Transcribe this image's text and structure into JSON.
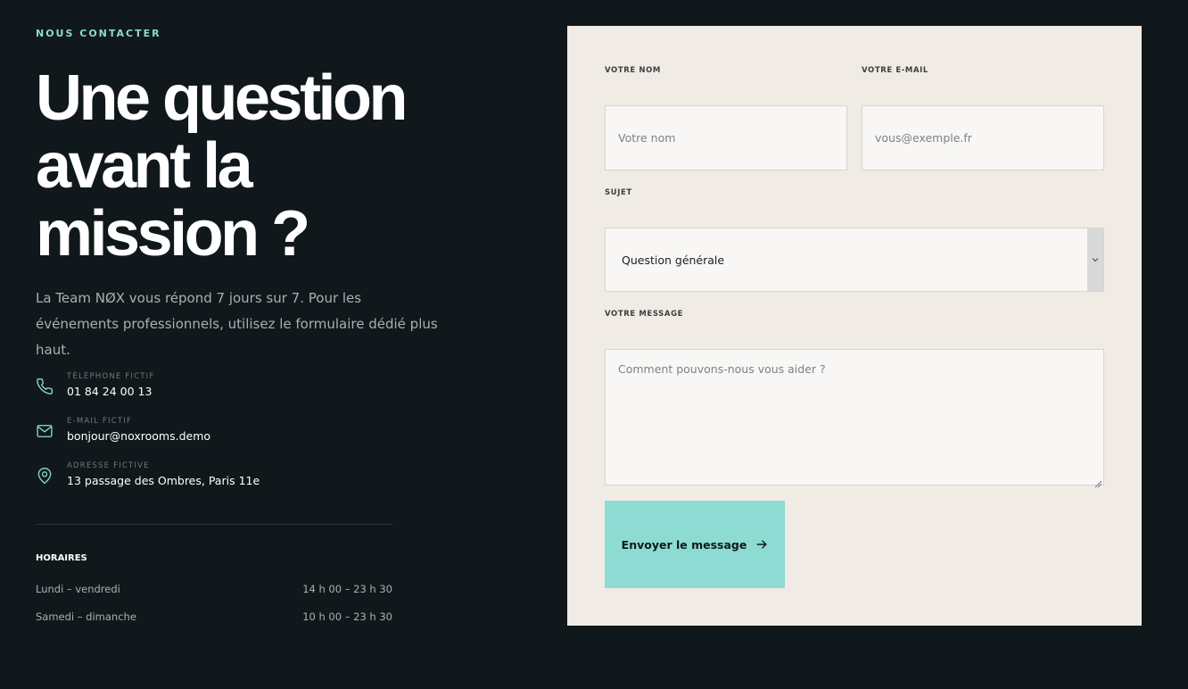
{
  "contact_section": {
    "eyebrow": "NOUS CONTACTER",
    "headline": "Une question avant la mission ?",
    "intro": "La Team NØX vous répond 7 jours sur 7. Pour les événements professionnels, utilisez le formulaire dédié plus haut.",
    "contacts": [
      {
        "icon": "phone-icon",
        "label": "TÉLÉPHONE FICTIF",
        "value": "01 84 24 00 13"
      },
      {
        "icon": "mail-icon",
        "label": "E-MAIL FICTIF",
        "value": "bonjour@noxrooms.demo"
      },
      {
        "icon": "map-pin-icon",
        "label": "ADRESSE FICTIVE",
        "value": "13 passage des Ombres, Paris 11e"
      }
    ],
    "hours": {
      "title": "HORAIRES",
      "rows": [
        {
          "days": "Lundi – vendredi",
          "time": "14 h 00 – 23 h 30"
        },
        {
          "days": "Samedi – dimanche",
          "time": "10 h 00 – 23 h 30"
        }
      ]
    }
  },
  "form": {
    "name": {
      "label": "VOTRE NOM",
      "placeholder": "Votre nom",
      "value": ""
    },
    "email": {
      "label": "VOTRE E-MAIL",
      "placeholder": "vous@exemple.fr",
      "value": ""
    },
    "subject": {
      "label": "SUJET",
      "selected": "Question générale"
    },
    "message": {
      "label": "VOTRE MESSAGE",
      "placeholder": "Comment pouvons-nous vous aider ?",
      "value": ""
    },
    "submit_label": "Envoyer le message"
  },
  "colors": {
    "background": "#11181b",
    "accent": "#8ddbd2",
    "panel": "#f0ebe4",
    "muted_text": "#a9b0b3"
  }
}
